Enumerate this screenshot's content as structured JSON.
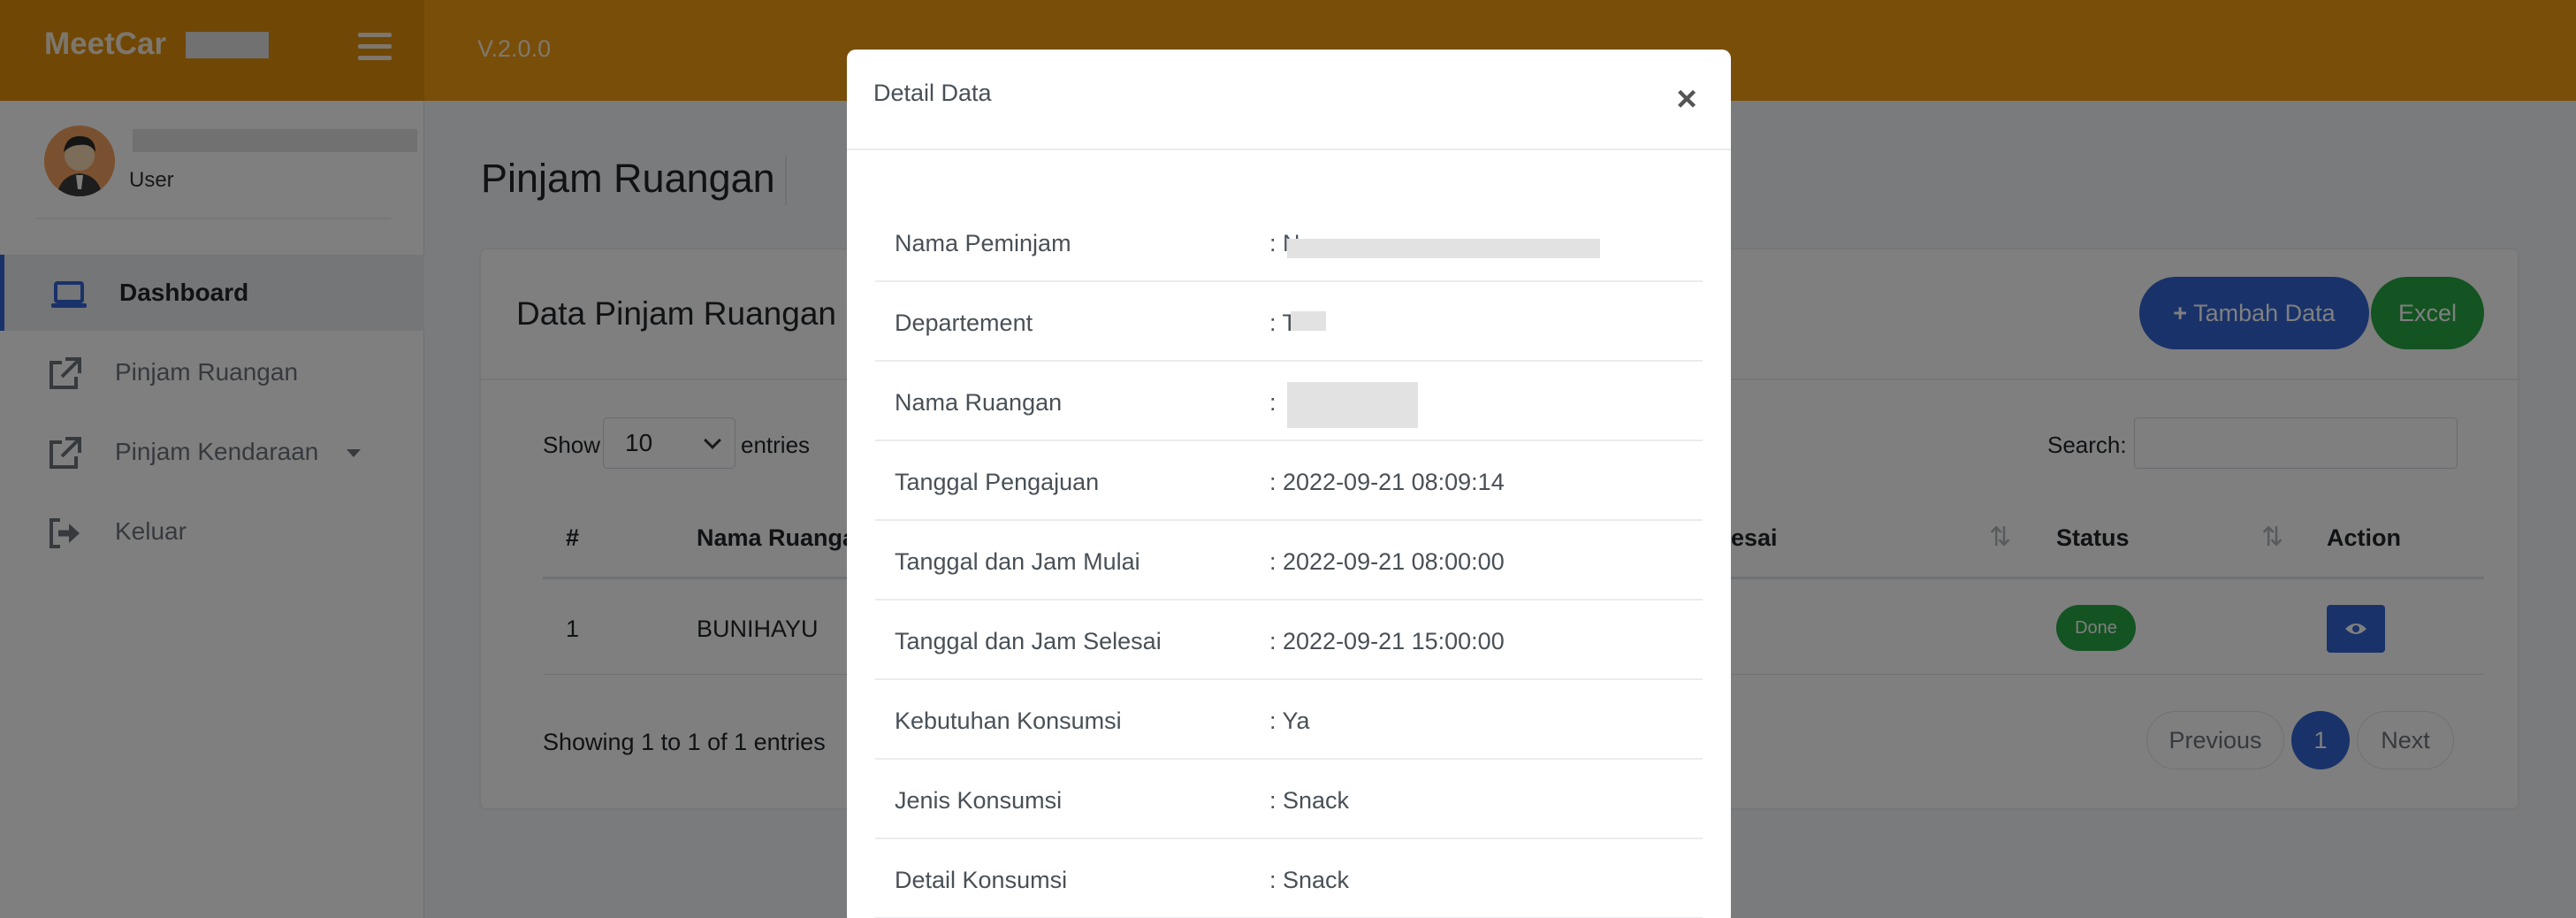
{
  "header": {
    "brand": "MeetCar",
    "version": "V.2.0.0"
  },
  "sidebar": {
    "user_role": "User",
    "items": [
      {
        "label": "Dashboard",
        "icon": "laptop-icon"
      },
      {
        "label": "Pinjam Ruangan",
        "icon": "external-link-icon"
      },
      {
        "label": "Pinjam Kendaraan",
        "icon": "external-link-icon"
      },
      {
        "label": "Keluar",
        "icon": "sign-out-icon"
      }
    ]
  },
  "page": {
    "title": "Pinjam Ruangan"
  },
  "card": {
    "title": "Data Pinjam Ruangan",
    "add_button": "Tambah Data",
    "excel_button": "Excel",
    "show_label": "Show",
    "entries_value": "10",
    "entries_label": "entries",
    "search_label": "Search:",
    "columns": [
      "#",
      "Nama Ruanga",
      "esai",
      "Status",
      "Action"
    ],
    "rows": [
      {
        "no": "1",
        "nama_ruangan": "BUNIHAYU",
        "status": "Done"
      }
    ],
    "showing_text": "Showing 1 to 1 of 1 entries",
    "pagination": {
      "previous": "Previous",
      "current": "1",
      "next": "Next"
    }
  },
  "modal": {
    "title": "Detail Data",
    "close": "×",
    "rows": [
      {
        "label": "Nama Peminjam",
        "value": ": N"
      },
      {
        "label": "Departement",
        "value": ": T"
      },
      {
        "label": "Nama Ruangan",
        "value": ":"
      },
      {
        "label": "Tanggal Pengajuan",
        "value": ": 2022-09-21 08:09:14"
      },
      {
        "label": "Tanggal dan Jam Mulai",
        "value": ": 2022-09-21 08:00:00"
      },
      {
        "label": "Tanggal dan Jam Selesai",
        "value": ": 2022-09-21 15:00:00"
      },
      {
        "label": "Kebutuhan Konsumsi",
        "value": ": Ya"
      },
      {
        "label": "Jenis Konsumsi",
        "value": ": Snack"
      },
      {
        "label": "Detail Konsumsi",
        "value": ": Snack"
      }
    ]
  },
  "colors": {
    "topbar": "#f39c12",
    "brand_bg": "#e08e0b",
    "primary": "#3365d4",
    "success": "#28a745"
  }
}
